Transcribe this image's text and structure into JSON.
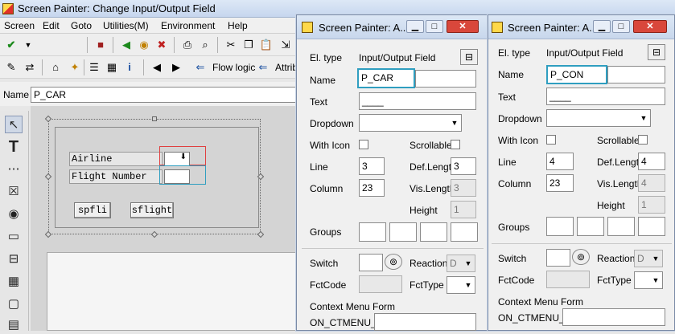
{
  "main": {
    "title": "Screen Painter:  Change Input/Output Field",
    "menu": [
      "Screen",
      "Edit",
      "Goto",
      "Utilities(M)",
      "Environment",
      "Help"
    ],
    "toolbar2": {
      "flow_logic": "Flow logic",
      "attrib": "Attrib"
    },
    "name_label": "Name",
    "name_value": "P_CAR"
  },
  "layout": {
    "airline_label": "Airline",
    "flight_number_label": "Flight Number",
    "button1": "spfli",
    "button2": "sflight"
  },
  "attr1": {
    "title": "Screen Painter: A...",
    "el_type_label": "El. type",
    "el_type_value": "Input/Output Field",
    "name_label": "Name",
    "name_value": "P_CAR",
    "text_label": "Text",
    "text_value": "____",
    "dropdown_label": "Dropdown",
    "with_icon_label": "With Icon",
    "scrollable_label": "Scrollable",
    "line_label": "Line",
    "line_value": "3",
    "deflength_label": "Def.Lengt",
    "deflength_value": "3",
    "column_label": "Column",
    "column_value": "23",
    "vislength_label": "Vis.Length",
    "vislength_value": "3",
    "height_label": "Height",
    "height_value": "1",
    "groups_label": "Groups",
    "switch_label": "Switch",
    "reaction_label": "Reaction",
    "reaction_value": "D",
    "fctcode_label": "FctCode",
    "fcttype_label": "FctType",
    "context_menu_label": "Context Menu Form",
    "on_ctmenu_label": "ON_CTMENU_"
  },
  "attr2": {
    "title": "Screen Painter: A...",
    "el_type_label": "El. type",
    "el_type_value": "Input/Output Field",
    "name_label": "Name",
    "name_value": "P_CON",
    "text_label": "Text",
    "text_value": "____",
    "dropdown_label": "Dropdown",
    "with_icon_label": "With Icon",
    "scrollable_label": "Scrollable",
    "line_label": "Line",
    "line_value": "4",
    "deflength_label": "Def.Lengt",
    "deflength_value": "4",
    "column_label": "Column",
    "column_value": "23",
    "vislength_label": "Vis.Length",
    "vislength_value": "4",
    "height_label": "Height",
    "height_value": "1",
    "groups_label": "Groups",
    "switch_label": "Switch",
    "reaction_label": "Reaction",
    "reaction_value": "D",
    "fctcode_label": "FctCode",
    "fcttype_label": "FctType",
    "context_menu_label": "Context Menu Form",
    "on_ctmenu_label": "ON_CTMENU_"
  }
}
